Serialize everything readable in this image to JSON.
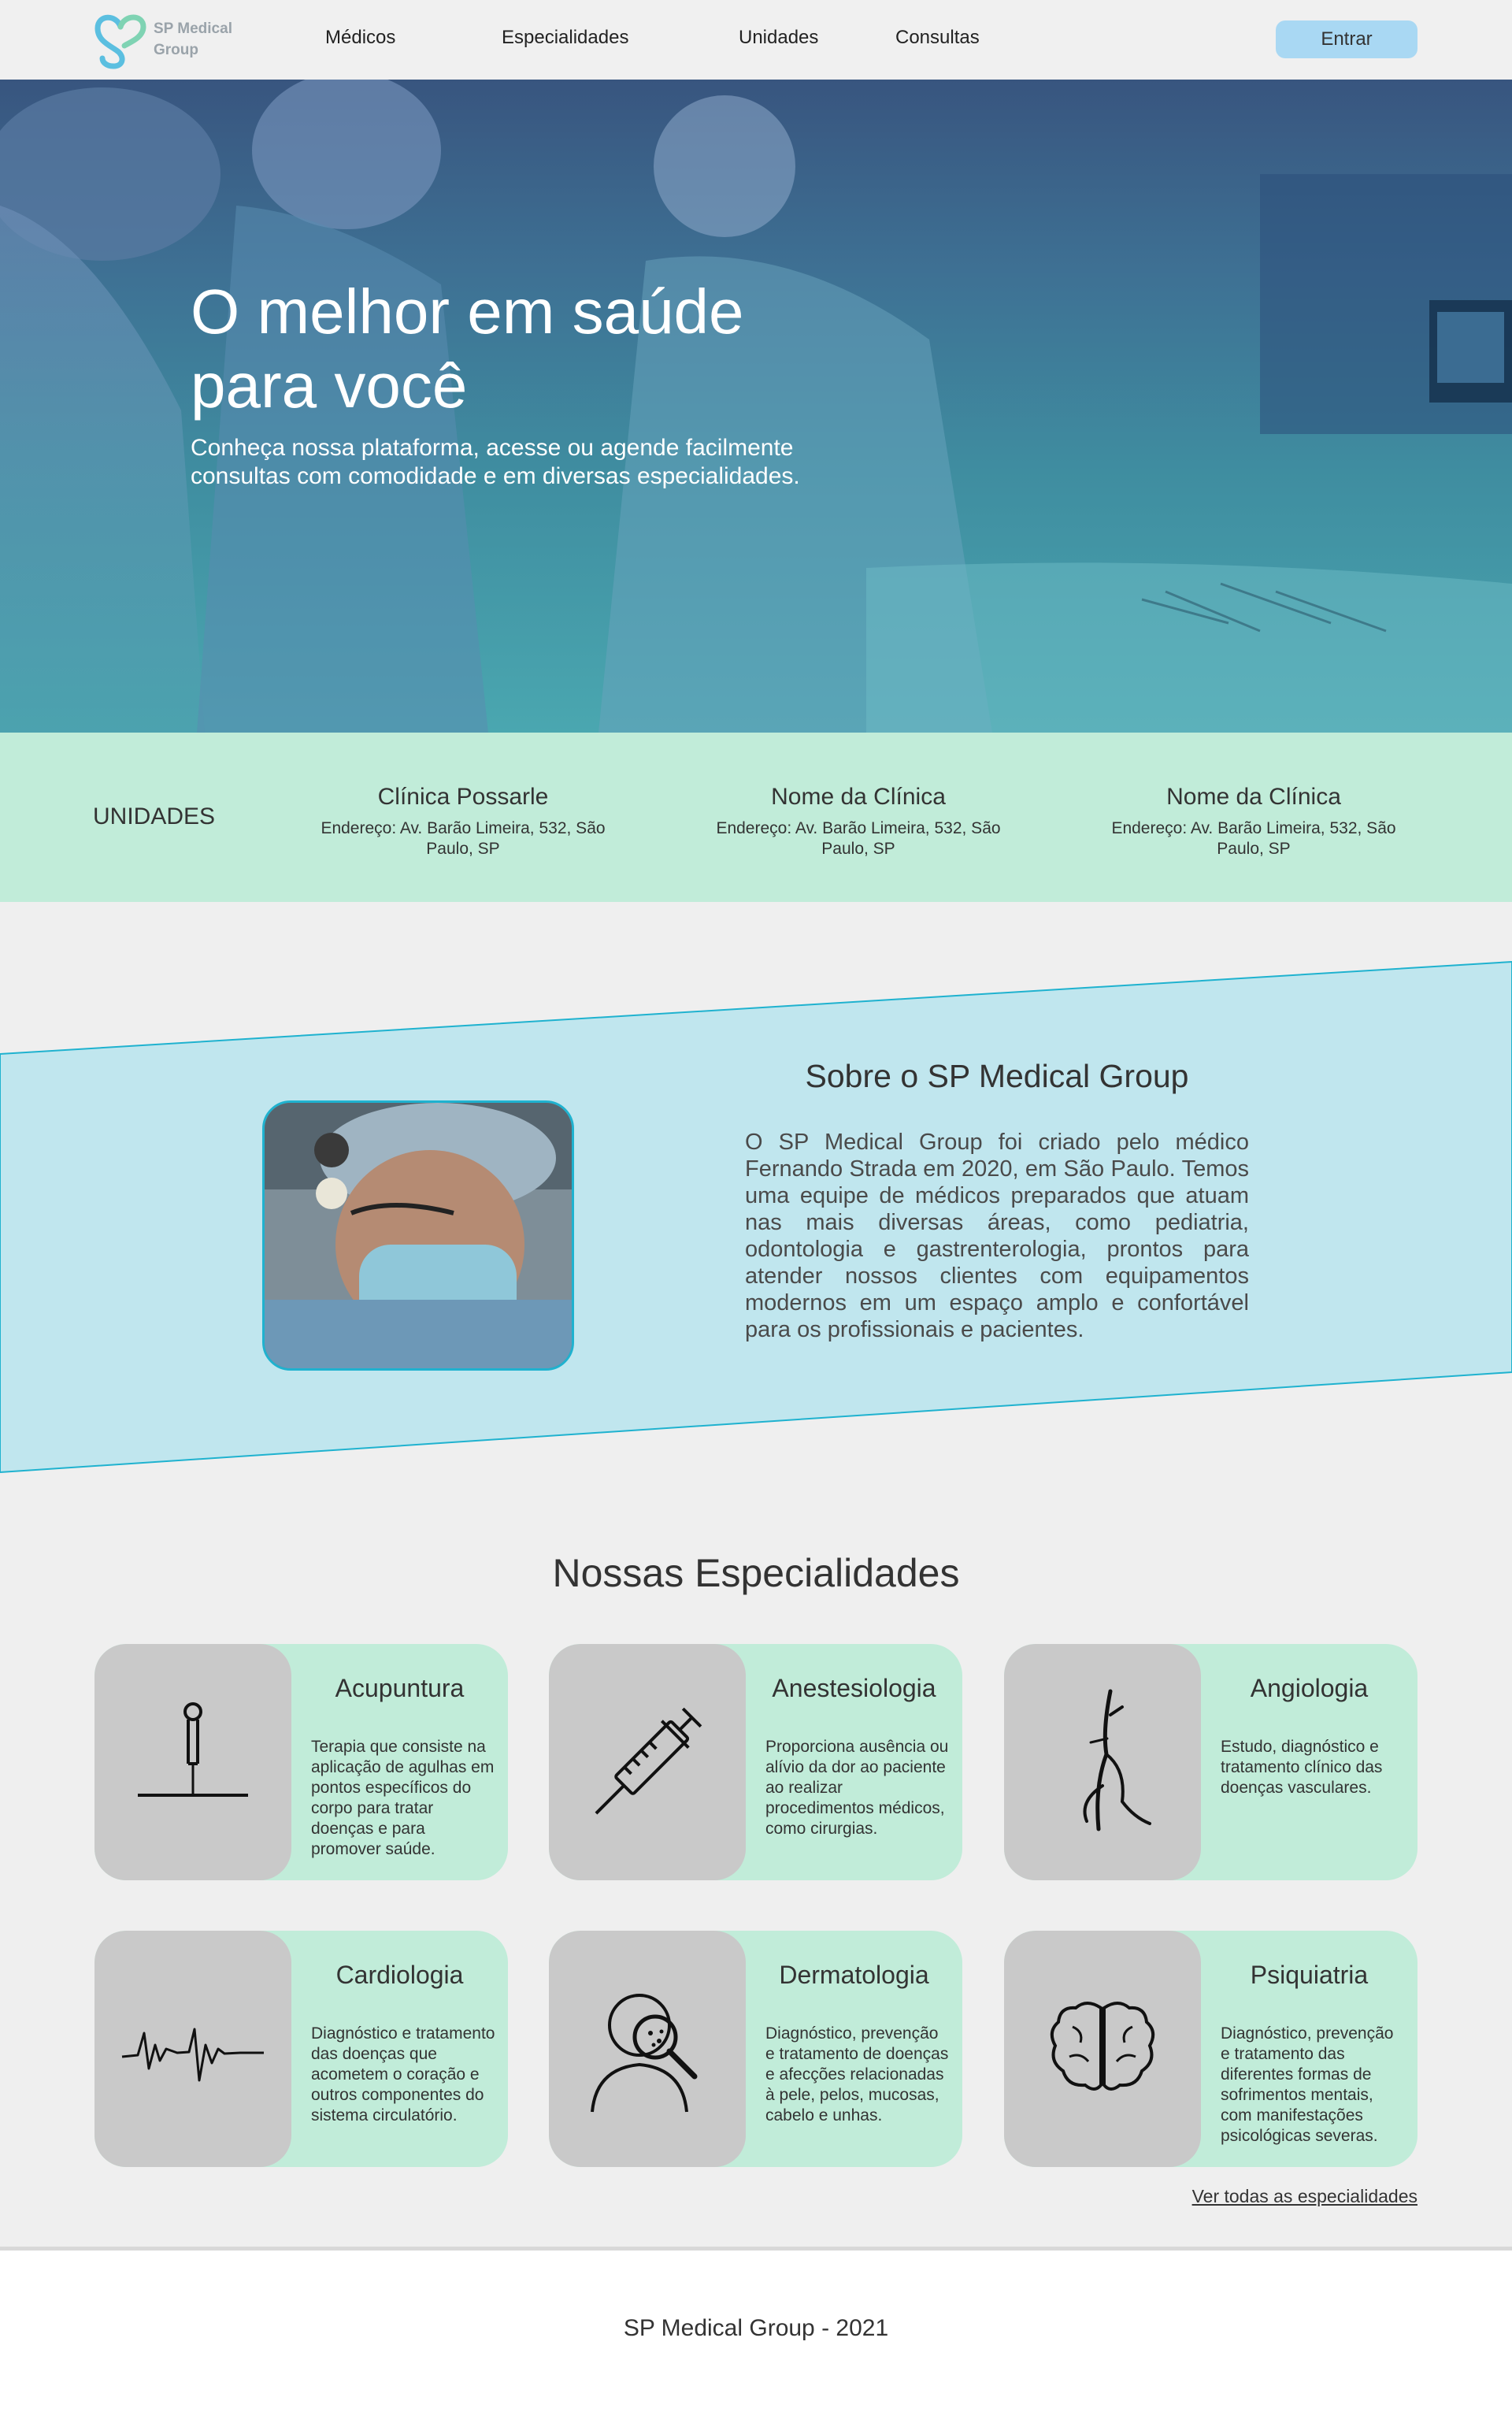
{
  "header": {
    "logo_text_line1": "SP Medical",
    "logo_text_line2": "Group",
    "nav": [
      "Médicos",
      "Especialidades",
      "Unidades",
      "Consultas"
    ],
    "login_label": "Entrar"
  },
  "hero": {
    "title_line1": "O melhor em saúde",
    "title_line2": "para você",
    "subtitle_line1": "Conheça nossa plataforma, acesse ou agende facilmente",
    "subtitle_line2": "consultas com comodidade e em diversas especialidades."
  },
  "units": {
    "label": "UNIDADES",
    "items": [
      {
        "name": "Clínica Possarle",
        "address_line1": "Endereço: Av. Barão Limeira, 532, São",
        "address_line2": "Paulo, SP"
      },
      {
        "name": "Nome da Clínica",
        "address_line1": "Endereço: Av. Barão Limeira, 532, São",
        "address_line2": "Paulo, SP"
      },
      {
        "name": "Nome da Clínica",
        "address_line1": "Endereço: Av. Barão Limeira, 532, São",
        "address_line2": "Paulo, SP"
      }
    ]
  },
  "about": {
    "title": "Sobre o SP Medical Group",
    "text": "O SP Medical Group foi criado pelo médico Fernando Strada em 2020, em São Paulo. Temos uma equipe de médicos preparados que atuam nas mais diversas áreas, como pediatria, odontologia e gastrenterologia, prontos para atender nossos clientes com equipamentos modernos em um espaço amplo e confortável para os profissionais e pacientes."
  },
  "specialties": {
    "title": "Nossas Especialidades",
    "items": [
      {
        "name": "Acupuntura",
        "icon": "acupuncture-needle-icon",
        "description": "Terapia que consiste na aplicação de agulhas em pontos específicos do corpo para tratar doenças e para promover saúde."
      },
      {
        "name": "Anestesiologia",
        "icon": "syringe-icon",
        "description": "Proporciona ausência ou alívio da dor ao paciente ao realizar procedimentos médicos, como cirurgias."
      },
      {
        "name": "Angiologia",
        "icon": "blood-vessel-icon",
        "description": "Estudo, diagnóstico e tratamento clínico das doenças vasculares."
      },
      {
        "name": "Cardiologia",
        "icon": "heartbeat-icon",
        "description": "Diagnóstico e tratamento das doenças que acometem o coração e outros componentes do sistema circulatório."
      },
      {
        "name": "Dermatologia",
        "icon": "skin-inspection-icon",
        "description": "Diagnóstico, prevenção e tratamento de doenças e afecções relacionadas à pele, pelos, mucosas, cabelo e unhas."
      },
      {
        "name": "Psiquiatria",
        "icon": "brain-icon",
        "description": "Diagnóstico, prevenção e tratamento das diferentes formas de sofrimentos mentais, com manifestações psicológicas severas."
      }
    ],
    "see_all": "Ver todas as especialidades"
  },
  "footer": {
    "text": "SP Medical Group - 2021"
  },
  "colors": {
    "mint": "#c1ecd9",
    "light_blue": "#c0e6ee",
    "accent_cyan": "#1fb2cf",
    "button_blue": "#a9d8f3"
  }
}
